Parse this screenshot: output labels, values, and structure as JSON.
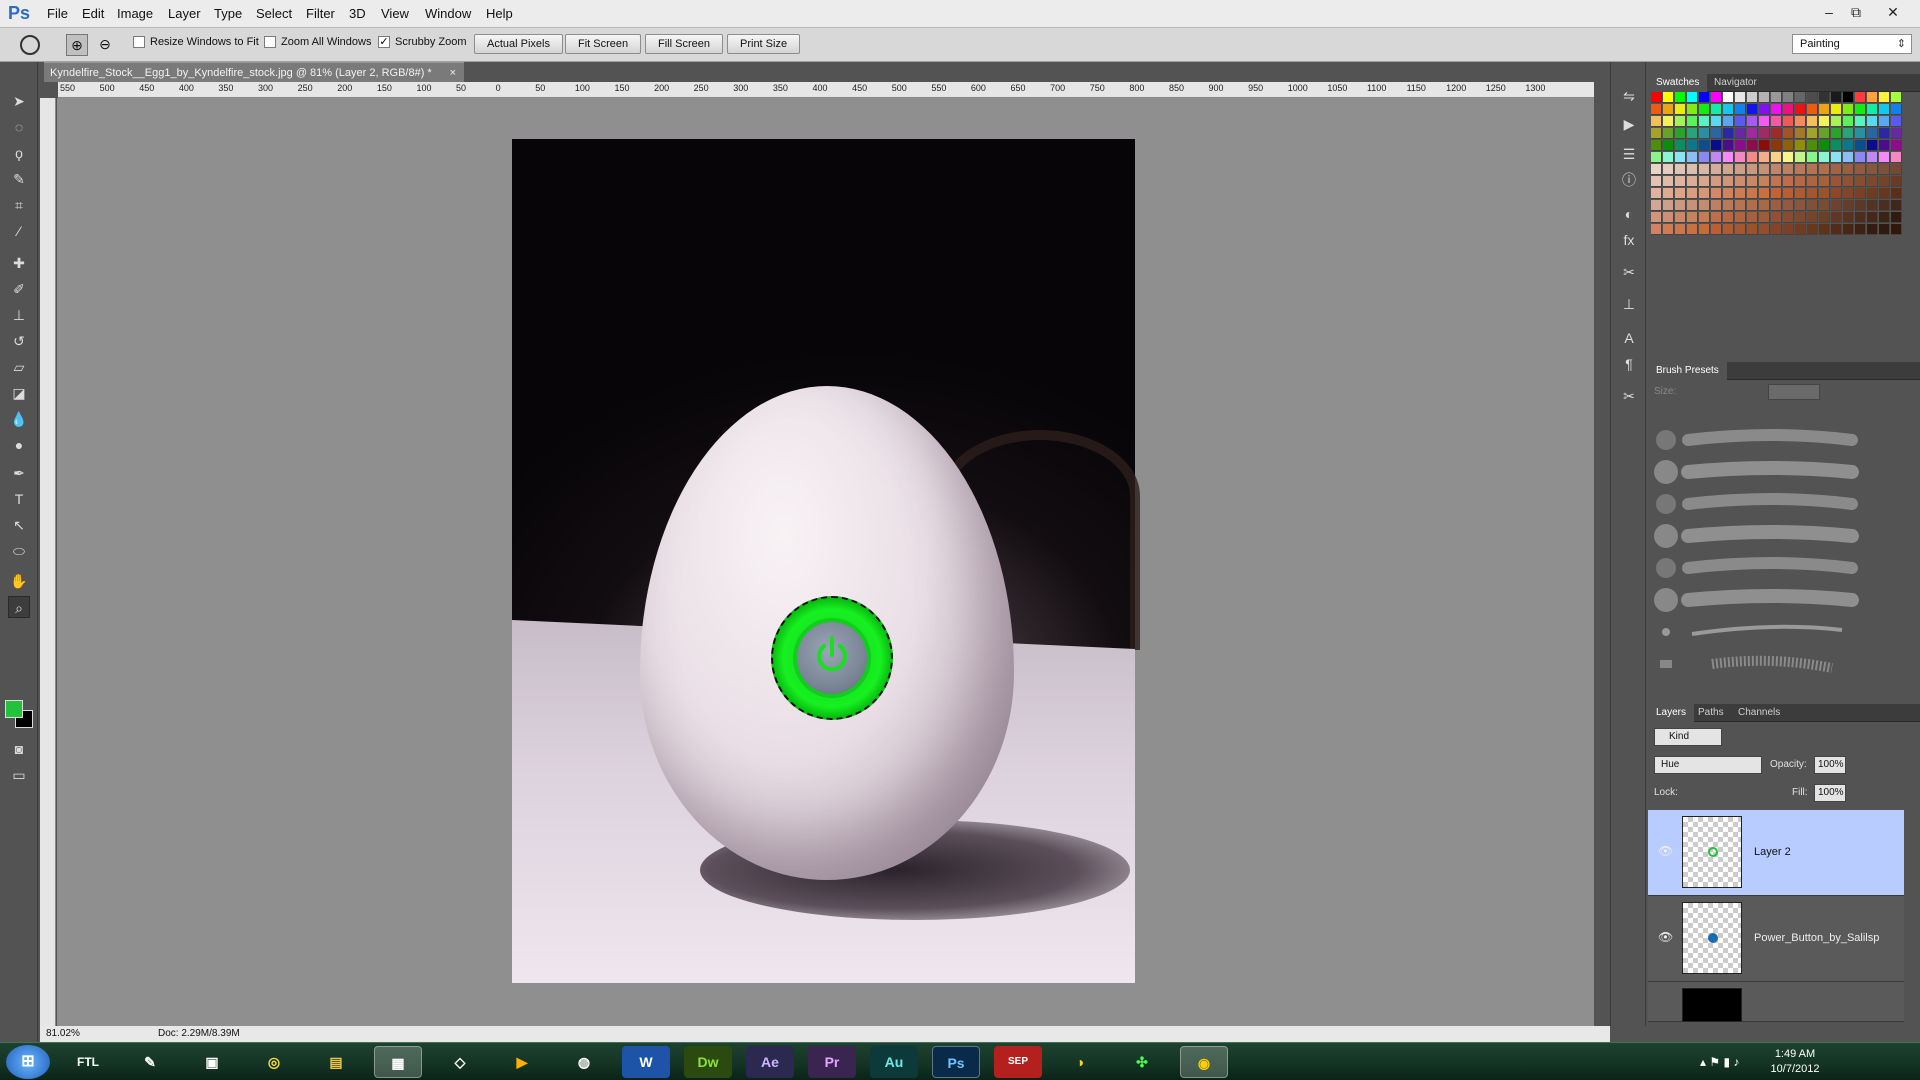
{
  "app": {
    "logo": "Ps",
    "menus": [
      "File",
      "Edit",
      "Image",
      "Layer",
      "Type",
      "Select",
      "Filter",
      "3D",
      "View",
      "Window",
      "Help"
    ]
  },
  "window_controls": {
    "minimize": "–",
    "restore": "⧉",
    "close": "✕"
  },
  "options_bar": {
    "checkboxes": [
      {
        "label": "Resize Windows to Fit",
        "checked": false
      },
      {
        "label": "Zoom All Windows",
        "checked": false
      },
      {
        "label": "Scrubby Zoom",
        "checked": true
      }
    ],
    "buttons": [
      "Actual Pixels",
      "Fit Screen",
      "Fill Screen",
      "Print Size"
    ],
    "workspace": "Painting"
  },
  "document": {
    "tab_title": "Kyndelfire_Stock__Egg1_by_Kyndelfire_stock.jpg @ 81% (Layer 2, RGB/8#) *",
    "close": "×",
    "ruler_labels": [
      "550",
      "500",
      "450",
      "400",
      "350",
      "300",
      "250",
      "200",
      "150",
      "100",
      "50",
      "0",
      "50",
      "100",
      "150",
      "200",
      "250",
      "300",
      "350",
      "400",
      "450",
      "500",
      "550",
      "600",
      "650",
      "700",
      "750",
      "800",
      "850",
      "900",
      "950",
      "1000",
      "1050",
      "1100",
      "1150",
      "1200",
      "1250",
      "1300"
    ]
  },
  "colors": {
    "foreground": "#22c23a",
    "background": "#000000",
    "accent": "#b8ccff"
  },
  "tools": [
    "move-icon",
    "marquee-icon",
    "lasso-icon",
    "quick-select-icon",
    "crop-icon",
    "eyedropper-icon",
    "healing-icon",
    "brush-icon",
    "stamp-icon",
    "history-brush-icon",
    "eraser-icon",
    "bucket-icon",
    "blur-icon",
    "dodge-icon",
    "pen-icon",
    "type-icon",
    "path-select-icon",
    "shape-icon",
    "hand-icon",
    "zoom-icon"
  ],
  "panels": {
    "swatches_tabs": [
      "Swatches",
      "Navigator"
    ],
    "brush_presets": {
      "tab": "Brush Presets",
      "size_label": "Size:"
    },
    "layers": {
      "tabs": [
        "Layers",
        "Paths",
        "Channels"
      ],
      "kind": "Kind",
      "blend_mode": "Hue",
      "opacity_label": "Opacity:",
      "opacity": "100%",
      "lock_label": "Lock:",
      "fill_label": "Fill:",
      "fill": "100%",
      "rows": [
        {
          "name": "Layer 2",
          "selected": true
        },
        {
          "name": "Power_Button_by_Salilsp",
          "selected": false
        },
        {
          "name": "",
          "selected": false
        }
      ]
    }
  },
  "status": {
    "zoom": "81.02%",
    "doc": "Doc: 2.29M/8.39M"
  },
  "taskbar": {
    "apps": [
      "Start",
      "FTL",
      "Pen",
      "Terminal",
      "Radar",
      "Explorer",
      "Monitor",
      "Vector",
      "Media",
      "Globe",
      "W",
      "Dw",
      "Ae",
      "Pr",
      "Au",
      "Ps",
      "SEP",
      "Fruit",
      "Razer",
      "Chrome"
    ],
    "time": "1:49 AM",
    "date": "10/7/2012"
  }
}
